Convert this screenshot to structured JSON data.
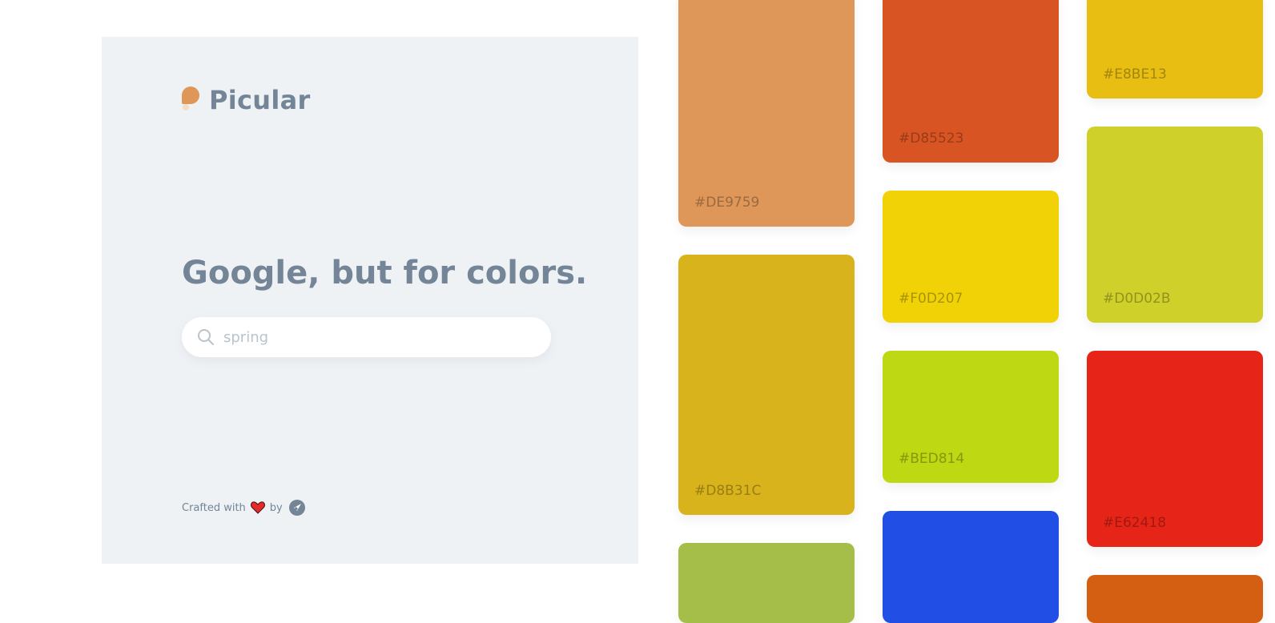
{
  "brand": {
    "name": "Picular",
    "logo_color": "#DE9759"
  },
  "headline": "Google, but for colors.",
  "search": {
    "value": "spring",
    "icon": "search-icon"
  },
  "footer": {
    "crafted_with": "Crafted with",
    "by": "by",
    "heart_icon": "heart-icon",
    "maker_icon": "rocket-icon"
  },
  "swatches": [
    {
      "hex": "#DE9759",
      "label": "#DE9759"
    },
    {
      "hex": "#D8B31C",
      "label": "#D8B31C"
    },
    {
      "hex": "#A5BE4A",
      "label": ""
    },
    {
      "hex": "#D85523",
      "label": "#D85523"
    },
    {
      "hex": "#F0D207",
      "label": "#F0D207"
    },
    {
      "hex": "#BED814",
      "label": "#BED814"
    },
    {
      "hex": "#214FE6",
      "label": ""
    },
    {
      "hex": "#E8BE13",
      "label": "#E8BE13"
    },
    {
      "hex": "#D0D02B",
      "label": "#D0D02B"
    },
    {
      "hex": "#E62418",
      "label": "#E62418"
    },
    {
      "hex": "#D45E12",
      "label": ""
    }
  ]
}
